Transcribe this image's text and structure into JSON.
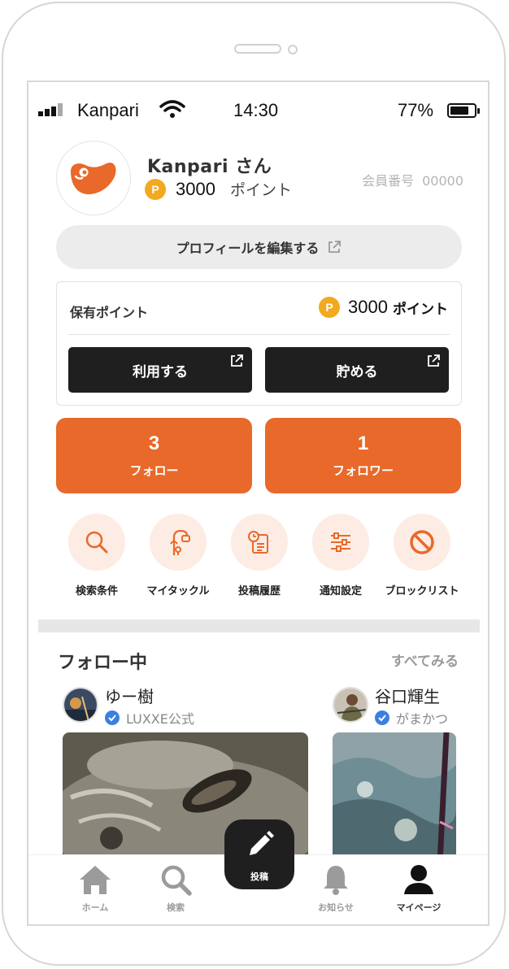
{
  "status_bar": {
    "carrier": "Kanpari",
    "time": "14:30",
    "battery": "77%",
    "battery_level": 0.77
  },
  "profile": {
    "name": "Kanpari さん",
    "points": "3000",
    "points_unit": "ポイント",
    "member_label": "会員番号",
    "member_number": "00000",
    "edit_button": "プロフィールを編集する",
    "mascot_color": "#e8692a"
  },
  "points_card": {
    "label": "保有ポイント",
    "points": "3000",
    "unit": "ポイント",
    "coin": "P",
    "use_button": "利用する",
    "save_button": "貯める"
  },
  "follow": {
    "following_count": "3",
    "following_label": "フォロー",
    "followers_count": "1",
    "followers_label": "フォロワー"
  },
  "shortcuts": [
    {
      "label": "検索条件",
      "icon": "search-icon"
    },
    {
      "label": "マイタックル",
      "icon": "fishing-reel-icon"
    },
    {
      "label": "投稿履歴",
      "icon": "history-document-icon"
    },
    {
      "label": "通知設定",
      "icon": "sliders-icon"
    },
    {
      "label": "ブロックリスト",
      "icon": "block-icon"
    }
  ],
  "following_section": {
    "title": "フォロー中",
    "see_all": "すべてみる",
    "posts": [
      {
        "name": "ゆー樹",
        "badge": "LUXXE公式"
      },
      {
        "name": "谷口輝生",
        "badge": "がまかつ"
      }
    ]
  },
  "tabbar": {
    "home": "ホーム",
    "search": "検索",
    "post": "投稿",
    "notifications": "お知らせ",
    "mypage": "マイページ"
  },
  "colors": {
    "accent": "#e8692a",
    "accent_light": "#fdece3",
    "dark": "#1f1f1f",
    "coin": "#f2a91f",
    "verified": "#3d7fe0"
  }
}
